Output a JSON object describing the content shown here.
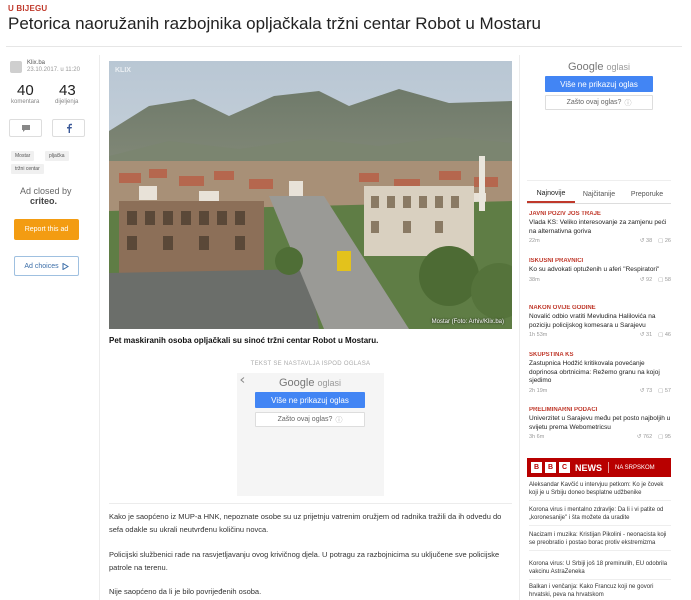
{
  "article": {
    "category": "U BIJEGU",
    "title": "Petorica naoružanih razbojnika opljačkala tržni centar Robot u Mostaru",
    "source": "Klix.ba",
    "date": "23.10.2017. u 11:20",
    "comments_count": "40",
    "comments_label": "komentara",
    "shares_count": "43",
    "shares_label": "dijeljenja",
    "tags": [
      "Mostar",
      "pljačka",
      "tržni centar"
    ],
    "photo_watermark": "KLIX",
    "photo_credit": "Mostar (Foto: Arhiv/Klix.ba)",
    "caption": "Pet maskiranih osoba opljačkali su sinoć tržni centar Robot u Mostaru.",
    "ad_label": "TEKST SE NASTAVLJA ISPOD OGLASA",
    "paragraphs": [
      "Kako je saopćeno iz MUP-a HNK, nepoznate osobe su uz prijetnju vatrenim oružjem od radnika tražili da ih odvedu do sefa odakle su ukrali neutvrđenu količinu novca.",
      "Policijski službenici rade na rasvjetljavanju ovog krivičnog djela. U potragu za razbojnicima su uključene sve policijske patrole na terenu.",
      "Nije saopćeno da li je bilo povrijeđenih osoba."
    ]
  },
  "ad_left": {
    "closed_text": "Ad closed by",
    "closed_brand": "criteo.",
    "report_label": "Report this ad",
    "adchoices_label": "Ad choices"
  },
  "google_ad": {
    "brand": "Google",
    "oglasi": "oglasi",
    "hide_label": "Više ne prikazuj oglas",
    "why_label": "Zašto ovaj oglas?",
    "info_glyph": "ⓘ"
  },
  "sidebar": {
    "tabs": [
      "Najnovije",
      "Najčitanije",
      "Preporuke"
    ],
    "active_tab": 0,
    "news": [
      {
        "cat": "JAVNI POZIV JOŠ TRAJE",
        "title": "Vlada KS: Veliko interesovanje za zamjenu peći na alternativna goriva",
        "time": "22m",
        "shares": "38",
        "comments": "26"
      },
      {
        "cat": "ISKUSNI PRAVNICI",
        "title": "Ko su advokati optuženih u aferi \"Respiratori\"",
        "time": "38m",
        "shares": "92",
        "comments": "58"
      },
      {
        "cat": "NAKON OVIJE GODINE",
        "title": "Novalić odbio vratiti Mevludina Halilovića na poziciju policijskog komesara u Sarajevu",
        "time": "1h 53m",
        "shares": "31",
        "comments": "46"
      },
      {
        "cat": "SKUPŠTINA KS",
        "title": "Zastupnica Hodžić kritikovala povećanje doprinosa obrtnicima: Režemo granu na kojoj sjedimo",
        "time": "2h 19m",
        "shares": "73",
        "comments": "57"
      },
      {
        "cat": "PRELIMINARNI PODACI",
        "title": "Univerzitet u Sarajevu među pet posto najboljih u svijetu prema Webometricsu",
        "time": "3h 6m",
        "shares": "762",
        "comments": "95"
      }
    ],
    "bbc": {
      "box": "B",
      "news_label": "NEWS",
      "lang_label": "NA SRPSKOM",
      "items": [
        "Aleksandar Kavčić u intervjuu petkom: Ko je čovek koji je u Srbiju doneo besplatne udžbenike",
        "Korona virus i mentalno zdravlje: Da li i vi patite od „koronesanije\" i šta možete da uradite",
        "Nacizam i muzika: Kristijan Pikolini - neonacista koji se preobratio i postao borac protiv ekstremizma",
        "Korona virus: U Srbiji još 18 preminulih, EU odobrila vakcinu AstraZeneka",
        "Balkan i venčanja: Kako Francuz koji ne govori hrvatski, peva na hrvatskom"
      ]
    }
  },
  "colors": {
    "accent": "#c0392b",
    "report_button": "#f39c12",
    "google_blue": "#4285f4",
    "bbc_red": "#b80000"
  }
}
